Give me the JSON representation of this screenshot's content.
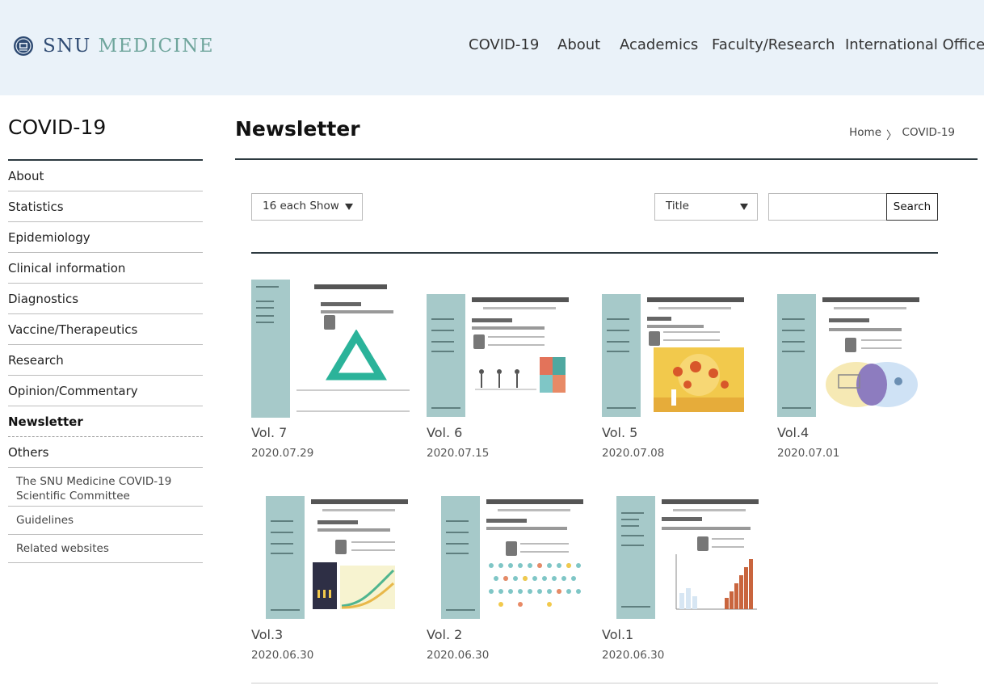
{
  "brand": {
    "word1": "SNU",
    "word2": "MEDICINE"
  },
  "nav": [
    "COVID-19",
    "About",
    "Academics",
    "Faculty/Research",
    "International Office"
  ],
  "sidebar": {
    "title": "COVID-19",
    "items": [
      "About",
      "Statistics",
      "Epidemiology",
      "Clinical information",
      "Diagnostics",
      "Vaccine/Therapeutics",
      "Research",
      "Opinion/Commentary",
      "Newsletter",
      "Others"
    ],
    "active": "Newsletter",
    "subitems": [
      "The SNU Medicine COVID-19 Scientific Committee",
      "Guidelines",
      "Related websites"
    ]
  },
  "main": {
    "title": "Newsletter",
    "breadcrumb": {
      "home": "Home",
      "separator": "〉",
      "current": "COVID-19"
    },
    "show_select": "16 each Show",
    "field_select": "Title",
    "search_value": "",
    "search_button": "Search"
  },
  "newsletters": [
    {
      "volume": "Vol. 7",
      "date": "2020.07.29"
    },
    {
      "volume": "Vol. 6",
      "date": "2020.07.15"
    },
    {
      "volume": "Vol. 5",
      "date": "2020.07.08"
    },
    {
      "volume": "Vol.4",
      "date": "2020.07.01"
    },
    {
      "volume": "Vol.3",
      "date": "2020.06.30"
    },
    {
      "volume": "Vol. 2",
      "date": "2020.06.30"
    },
    {
      "volume": "Vol.1",
      "date": "2020.06.30"
    }
  ],
  "colors": {
    "header_bg": "#eaf2f9",
    "brand_dark": "#2f4b73",
    "brand_green": "#6fa59c",
    "thumb_strip": "#a6c9c9"
  },
  "icons": {
    "dropdown": "caret-down-icon",
    "emblem": "snu-emblem-icon"
  }
}
